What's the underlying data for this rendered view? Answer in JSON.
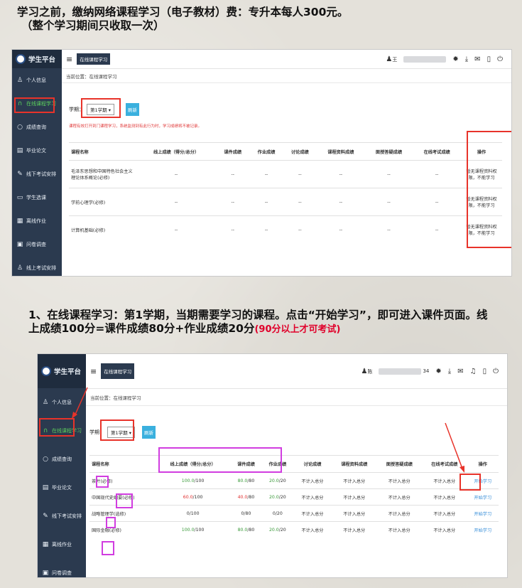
{
  "caption_top": {
    "line1": "学习之前，缴纳网络课程学习（电子教材）费：专升本每人300元。",
    "line2": "（整个学习期间只收取一次）"
  },
  "caption_mid": {
    "text": "1、在线课程学习：第1学期，当期需要学习的课程。点击“开始学习”，即可进入课件页面。线上成绩100分=课件成绩80分+作业成绩20分",
    "highlight": "(90分以上才可考试)"
  },
  "shot1": {
    "brand": "学生平台",
    "tab": "在线课程学习",
    "user": "王",
    "breadcrumb": "当前位置：在线课程学习",
    "term_label": "学期：",
    "term_value": "第1学期",
    "refresh": "刷新",
    "notice": "课程有效打开到门课程学习，系统监测到有此行为时，学习成绩将不被记录。",
    "nav": [
      {
        "label": "个人信息",
        "icon": "user-icon"
      },
      {
        "label": "在线课程学习",
        "icon": "headset-icon"
      },
      {
        "label": "成绩查询",
        "icon": "search-icon"
      },
      {
        "label": "毕业论文",
        "icon": "document-icon"
      },
      {
        "label": "线下考试安排",
        "icon": "edit-icon"
      },
      {
        "label": "学生选课",
        "icon": "card-icon"
      },
      {
        "label": "离线作业",
        "icon": "list-icon"
      },
      {
        "label": "问卷调查",
        "icon": "survey-icon"
      },
      {
        "label": "线上考试安排",
        "icon": "user-icon"
      }
    ],
    "columns": [
      "课程名称",
      "线上成绩（得分/总分）",
      "课件成绩",
      "作业成绩",
      "讨论成绩",
      "课程资料成绩",
      "面授答疑成绩",
      "在线考试成绩",
      "操作"
    ],
    "rows": [
      {
        "name": "毛泽东思想和中国特色社会主义理论体系概论(必修)",
        "vals": [
          "--",
          "--",
          "--",
          "--",
          "--",
          "--",
          "--"
        ],
        "op": "暂无课程资料权限，不能学习"
      },
      {
        "name": "学前心理学(必修)",
        "vals": [
          "--",
          "--",
          "--",
          "--",
          "--",
          "--",
          "--"
        ],
        "op": "暂无课程资料权限，不能学习"
      },
      {
        "name": "计算机基础(必修)",
        "vals": [
          "--",
          "--",
          "--",
          "--",
          "--",
          "--",
          "--"
        ],
        "op": "暂无课程资料权限，不能学习"
      }
    ]
  },
  "shot2": {
    "brand": "学生平台",
    "tab": "在线课程学习",
    "user": "陈",
    "user_suffix": "34",
    "breadcrumb": "当前位置：在线课程学习",
    "term_label": "学期：",
    "term_value": "第1学期",
    "refresh": "刷新",
    "nav": [
      {
        "label": "个人信息",
        "icon": "user-icon"
      },
      {
        "label": "在线课程学习",
        "icon": "headset-icon"
      },
      {
        "label": "成绩查询",
        "icon": "search-icon"
      },
      {
        "label": "毕业论文",
        "icon": "document-icon"
      },
      {
        "label": "线下考试安排",
        "icon": "edit-icon"
      },
      {
        "label": "离线作业",
        "icon": "list-icon"
      },
      {
        "label": "问卷调查",
        "icon": "survey-icon"
      }
    ],
    "columns": [
      "课程名称",
      "线上成绩（得分/总分）",
      "课件成绩",
      "作业成绩",
      "讨论成绩",
      "课程资料成绩",
      "面授答疑成绩",
      "在线考试成绩",
      "操作"
    ],
    "rows": [
      {
        "name": "茶叶(必修)",
        "online_a": "100.0",
        "online_b": "/100",
        "cw_a": "80.0",
        "cw_b": "/80",
        "hw_a": "20.0",
        "hw_b": "/20",
        "rest": [
          "不计入总分",
          "不计入总分",
          "不计入总分",
          "不计入总分"
        ],
        "op": "开始学习",
        "ca": "g"
      },
      {
        "name": "中国现代史纲要(必修)",
        "online_a": "60.0",
        "online_b": "/100",
        "cw_a": "40.0",
        "cw_b": "/80",
        "hw_a": "20.0",
        "hw_b": "/20",
        "rest": [
          "不计入总分",
          "不计入总分",
          "不计入总分",
          "不计入总分"
        ],
        "op": "开始学习",
        "ca": "r"
      },
      {
        "name": "战略管理学(选修)",
        "online_a": "0",
        "online_b": "/100",
        "cw_a": "0",
        "cw_b": "/80",
        "hw_a": "0",
        "hw_b": "/20",
        "rest": [
          "不计入总分",
          "不计入总分",
          "不计入总分",
          "不计入总分"
        ],
        "op": "开始学习",
        "ca": ""
      },
      {
        "name": "国际金融(必修)",
        "online_a": "100.0",
        "online_b": "/100",
        "cw_a": "80.0",
        "cw_b": "/80",
        "hw_a": "20.0",
        "hw_b": "/20",
        "rest": [
          "不计入总分",
          "不计入总分",
          "不计入总分",
          "不计入总分"
        ],
        "op": "开始学习",
        "ca": "g"
      }
    ]
  },
  "colors": {
    "sidebar": "#2b3a4f",
    "highlight_red": "#e8332a",
    "highlight_magenta": "#d13de0",
    "link": "#3a8fd9"
  }
}
